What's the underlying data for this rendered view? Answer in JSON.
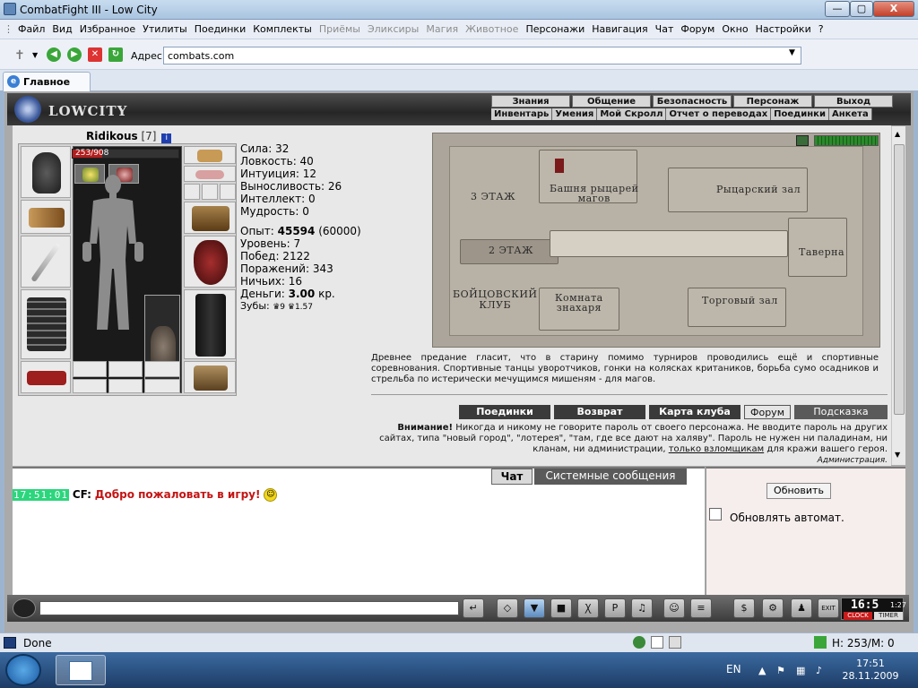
{
  "window": {
    "title": "CombatFight III - Low City",
    "min": "—",
    "max": "▢",
    "close": "X"
  },
  "menu": [
    "Файл",
    "Вид",
    "Избранное",
    "Утилиты",
    "Поединки",
    "Комплекты",
    "Приёмы",
    "Эликсиры",
    "Магия",
    "Животное",
    "Персонажи",
    "Навигация",
    "Чат",
    "Форум",
    "Окно",
    "Настройки",
    "?"
  ],
  "menu_disabled": [
    6,
    7,
    8,
    9
  ],
  "address": {
    "label": "Адрес:",
    "value": "combats.com"
  },
  "tab": {
    "label": "Главное"
  },
  "game": {
    "logo": "LOWCITY",
    "nav_top": [
      "Знания",
      "Общение",
      "Безопасность",
      "Персонаж",
      "Выход"
    ],
    "nav_sub": [
      "Инвентарь",
      "Умения",
      "Мой Скролл",
      "Отчет о переводах",
      "Поединки",
      "Анкета"
    ]
  },
  "character": {
    "name": "Ridikous",
    "level": "[7]",
    "info": "i",
    "hp": "253/908",
    "hp_fraction": 0.279
  },
  "stats": [
    {
      "label": "Сила: ",
      "value": "32"
    },
    {
      "label": "Ловкость: ",
      "value": "40"
    },
    {
      "label": "Интуиция: ",
      "value": "12"
    },
    {
      "label": "Выносливость: ",
      "value": "26"
    },
    {
      "label": "Интеллект: ",
      "value": "0"
    },
    {
      "label": "Мудрость: ",
      "value": "0"
    }
  ],
  "progress": {
    "exp_label": "Опыт: ",
    "exp": "45594",
    "exp_next": " (60000)",
    "rows": [
      "Уровень: 7",
      "Побед: 2122",
      "Поражений: 343",
      "Ничьих: 16"
    ],
    "money_label": "Деньги: ",
    "money": "3.00",
    "money_unit": " кр.",
    "teeth_label": "Зубы: ",
    "teeth": "♛9 ♛1.57"
  },
  "map": {
    "floor3": "3 ЭТАЖ",
    "floor2": "2 ЭТАЖ",
    "club": "БОЙЦОВСКИЙ\nКЛУБ",
    "rooms": [
      "Башня рыцарей\nмагов",
      "Рыцарский зал",
      "Таверна",
      "Комната\nзнахаря",
      "Торговый зал"
    ]
  },
  "lore": "Древнее предание гласит, что в старину помимо турниров проводились ещё и спортивные соревнования. Спортивные танцы уворотчиков, гонки на колясках критаников, борьба сумо осадников и стрельба по истерически мечущимся мишеням - для магов.",
  "actions": [
    "Поединки",
    "Возврат",
    "Карта клуба",
    "Форум",
    "Подсказка"
  ],
  "warning": {
    "bold": "Внимание!",
    "text": " Никогда и никому не говорите пароль от своего персонажа. Не вводите пароль на других сайтах, типа \"новый город\", \"лотерея\", \"там, где все дают на халяву\". Пароль не нужен ни паладинам, ни кланам, ни администрации, ",
    "link": "только взломщикам",
    "tail": " для кражи вашего героя.",
    "sign": "Администрация."
  },
  "chat": {
    "tabs": [
      "Чат",
      "Системные сообщения"
    ],
    "time": "17:51:01",
    "who": "CF:",
    "message": "Добро пожаловать в игру!"
  },
  "right": {
    "refresh": "Обновить",
    "auto": "Обновлять автомат."
  },
  "clock": {
    "time": "16:5",
    "sec": "1:27",
    "clock": "CLOCK",
    "timer": "TIMER"
  },
  "status": {
    "text": "Done",
    "hp": "H: 253/M: 0"
  },
  "taskbar": {
    "lang": "EN",
    "time": "17:51",
    "date": "28.11.2009"
  }
}
